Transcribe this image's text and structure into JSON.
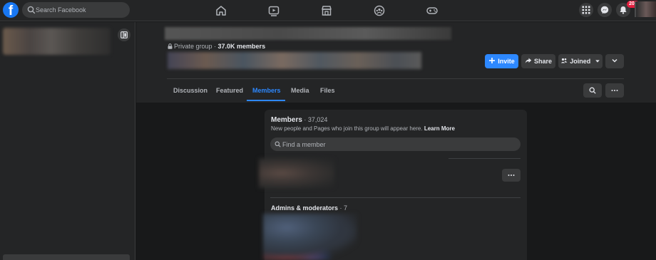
{
  "topbar": {
    "logo": "f",
    "search_placeholder": "Search Facebook",
    "nav_icons": [
      "home-icon",
      "watch-icon",
      "marketplace-icon",
      "groups-icon",
      "gaming-icon"
    ],
    "notification_badge": "20+"
  },
  "group": {
    "privacy_label": "Private group",
    "separator": " · ",
    "members_short": "37.0K members",
    "actions": {
      "invite_label": "Invite",
      "share_label": "Share",
      "joined_label": "Joined"
    },
    "tabs": [
      "Discussion",
      "Featured",
      "Members",
      "Media",
      "Files"
    ],
    "active_tab": "Members"
  },
  "members_card": {
    "title": "Members",
    "count": " · 37,024",
    "subtitle": "New people and Pages who join this group will appear here.",
    "learn_more": "Learn More",
    "find_placeholder": "Find a member",
    "admins_title": "Admins & moderators",
    "admins_count": " · 7"
  },
  "colors": {
    "accent": "#2d88ff",
    "brand": "#1877f2",
    "badge": "#e41e3f",
    "background": "#18191a",
    "surface": "#242526"
  }
}
